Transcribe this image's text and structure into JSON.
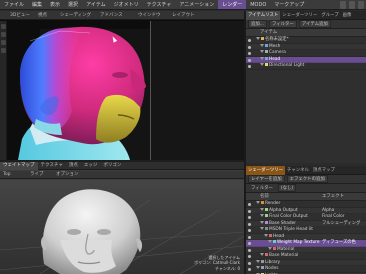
{
  "menubar": {
    "items": [
      "ファイル",
      "編集",
      "表示",
      "選択",
      "アイテム",
      "ジオメトリ",
      "テクスチャ",
      "アニメーション",
      "レンダー",
      "MODO",
      "マークアップ"
    ],
    "active_index": 8
  },
  "viewport1": {
    "header": [
      "3Dビュー",
      "視点",
      "シェーディング",
      "アドバンス",
      "ウインドウ",
      "レイアウト"
    ]
  },
  "viewport2": {
    "tabs": [
      "ウェイトマップ",
      "テクスチャ",
      "頂点",
      "エッジ",
      "ポリゴン"
    ],
    "header": [
      "Top",
      "ライブ",
      "オプション"
    ],
    "info_lines": [
      "選択したアイテム",
      "ポリゴン: Catmull-Clark",
      "チャンネル: 0"
    ]
  },
  "item_panel": {
    "tabs": [
      "アイテムリスト",
      "シェーダーツリー",
      "グループ",
      "画像"
    ],
    "active_tab": 0,
    "controls": [
      "追加...",
      "フィルター",
      "アイテム追加"
    ],
    "column_header": "アイテム",
    "items": [
      {
        "label": "名称未設定*",
        "indent": 1,
        "icon": "scene-icon",
        "selected": false
      },
      {
        "label": "Mesh",
        "indent": 2,
        "icon": "mesh-icon",
        "selected": false
      },
      {
        "label": "Camera",
        "indent": 2,
        "icon": "camera-icon",
        "selected": false
      },
      {
        "label": "Head",
        "indent": 2,
        "icon": "mesh-icon",
        "selected": true
      },
      {
        "label": "Directional Light",
        "indent": 2,
        "icon": "light-icon",
        "selected": false
      }
    ]
  },
  "shader_panel": {
    "tabs": [
      "シェーダーツリー",
      "チャンネル",
      "頂点マップ"
    ],
    "active_tab": 0,
    "controls": [
      "レイヤーを追加",
      "エフェクトの追加"
    ],
    "filter_label": "フィルター",
    "filter_value": "(なし)",
    "col_name": "名前",
    "col_effect": "エフェクト",
    "rows": [
      {
        "label": "Render",
        "indent": 1,
        "effect": "",
        "icon": "render-icon",
        "selected": false
      },
      {
        "label": "Alpha Output",
        "indent": 2,
        "effect": "Alpha",
        "icon": "output-icon",
        "selected": false
      },
      {
        "label": "Final Color Output",
        "indent": 2,
        "effect": "Final Color",
        "icon": "output-icon",
        "selected": false
      },
      {
        "label": "Base Shader",
        "indent": 2,
        "effect": "フルシェーディング",
        "icon": "shader-icon",
        "selected": false
      },
      {
        "label": "MSDN Triple Head lit",
        "indent": 2,
        "effect": "",
        "icon": "group-icon",
        "selected": false
      },
      {
        "label": "Head",
        "indent": 3,
        "effect": "",
        "icon": "material-icon",
        "selected": false
      },
      {
        "label": "Weight Map Texture",
        "indent": 4,
        "effect": "ディフューズの色",
        "icon": "texture-icon",
        "selected": true
      },
      {
        "label": "Material",
        "indent": 4,
        "effect": "",
        "icon": "material-icon",
        "selected": false
      },
      {
        "label": "Base Material",
        "indent": 2,
        "effect": "",
        "icon": "material-icon",
        "selected": false
      },
      {
        "label": "Library",
        "indent": 1,
        "effect": "",
        "icon": "library-icon",
        "selected": false
      },
      {
        "label": "Nodes",
        "indent": 1,
        "effect": "",
        "icon": "nodes-icon",
        "selected": false
      },
      {
        "label": "Lights",
        "indent": 1,
        "effect": "",
        "icon": "light-icon",
        "selected": false
      }
    ]
  },
  "colors": {
    "accent": "#6a4e92",
    "selection_orange": "#8a5618"
  }
}
